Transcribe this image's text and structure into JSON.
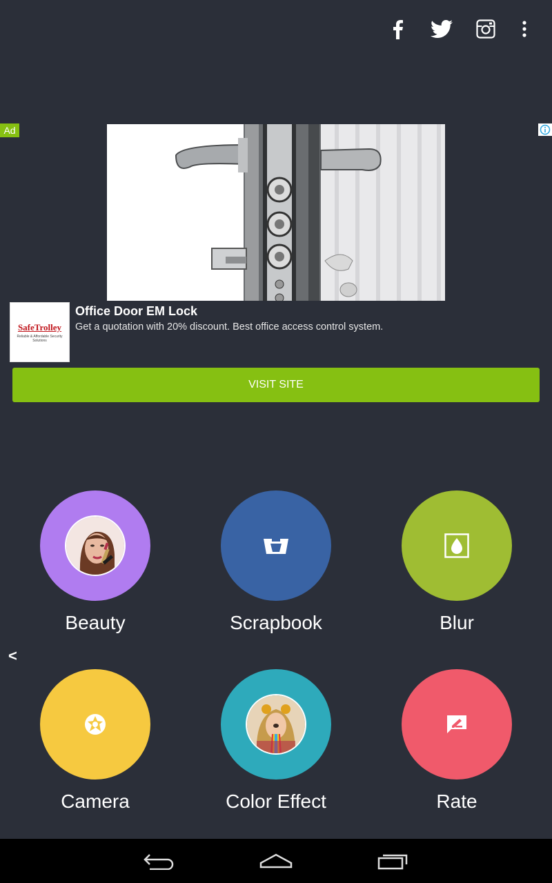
{
  "top_bar": {
    "icons": [
      "facebook-icon",
      "twitter-icon",
      "instagram-icon",
      "more-vert-icon"
    ]
  },
  "ad": {
    "badge": "Ad",
    "title": "Office Door EM Lock",
    "description": "Get a quotation with 20% discount. Best office access control system.",
    "logo_text": "SafeTrolley",
    "logo_subtext": "Reliable & Affordable Security Solutions",
    "button_label": "VISIT SITE",
    "accent_color": "#86c012"
  },
  "tiles": [
    {
      "label": "Beauty",
      "color": "#b07cf0",
      "icon": "beauty-photo"
    },
    {
      "label": "Scrapbook",
      "color": "#3963a4",
      "icon": "scrapbook-icon"
    },
    {
      "label": "Blur",
      "color": "#9fbd33",
      "icon": "blur-drop-icon"
    },
    {
      "label": "Camera",
      "color": "#f6c940",
      "icon": "camera-shutter-icon"
    },
    {
      "label": "Color Effect",
      "color": "#2eaabb",
      "icon": "color-effect-photo"
    },
    {
      "label": "Rate",
      "color": "#f05a6b",
      "icon": "rate-feedback-icon"
    }
  ],
  "side_arrow": "<",
  "nav": [
    "back-icon",
    "home-icon",
    "recent-apps-icon"
  ]
}
